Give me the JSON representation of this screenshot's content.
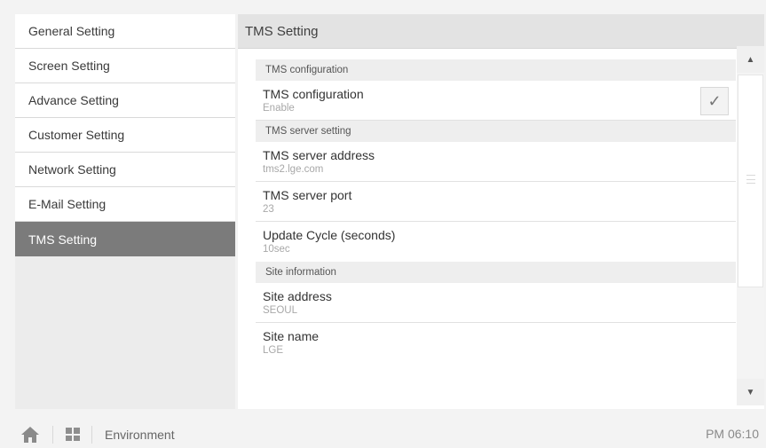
{
  "sidebar": {
    "items": [
      {
        "label": "General Setting"
      },
      {
        "label": "Screen Setting"
      },
      {
        "label": "Advance Setting"
      },
      {
        "label": "Customer Setting"
      },
      {
        "label": "Network Setting"
      },
      {
        "label": "E-Mail Setting"
      },
      {
        "label": "TMS Setting"
      }
    ],
    "active_index": 6
  },
  "main": {
    "title": "TMS Setting",
    "sections": [
      {
        "header": "TMS configuration",
        "rows": [
          {
            "title": "TMS configuration",
            "value": "Enable",
            "checkbox": true
          }
        ]
      },
      {
        "header": "TMS server setting",
        "rows": [
          {
            "title": "TMS server address",
            "value": "tms2.lge.com"
          },
          {
            "title": "TMS server port",
            "value": "23"
          },
          {
            "title": "Update Cycle (seconds)",
            "value": "10sec"
          }
        ]
      },
      {
        "header": "Site information",
        "rows": [
          {
            "title": "Site address",
            "value": "SEOUL"
          },
          {
            "title": "Site name",
            "value": "LGE"
          }
        ]
      }
    ],
    "checkbox_icon": "checkmark-icon"
  },
  "scrollbar": {
    "up_icon": "triangle-up-icon",
    "down_icon": "triangle-down-icon"
  },
  "bottombar": {
    "home_icon": "home-icon",
    "apps_icon": "grid-icon",
    "label": "Environment",
    "time": "PM 06:10"
  }
}
